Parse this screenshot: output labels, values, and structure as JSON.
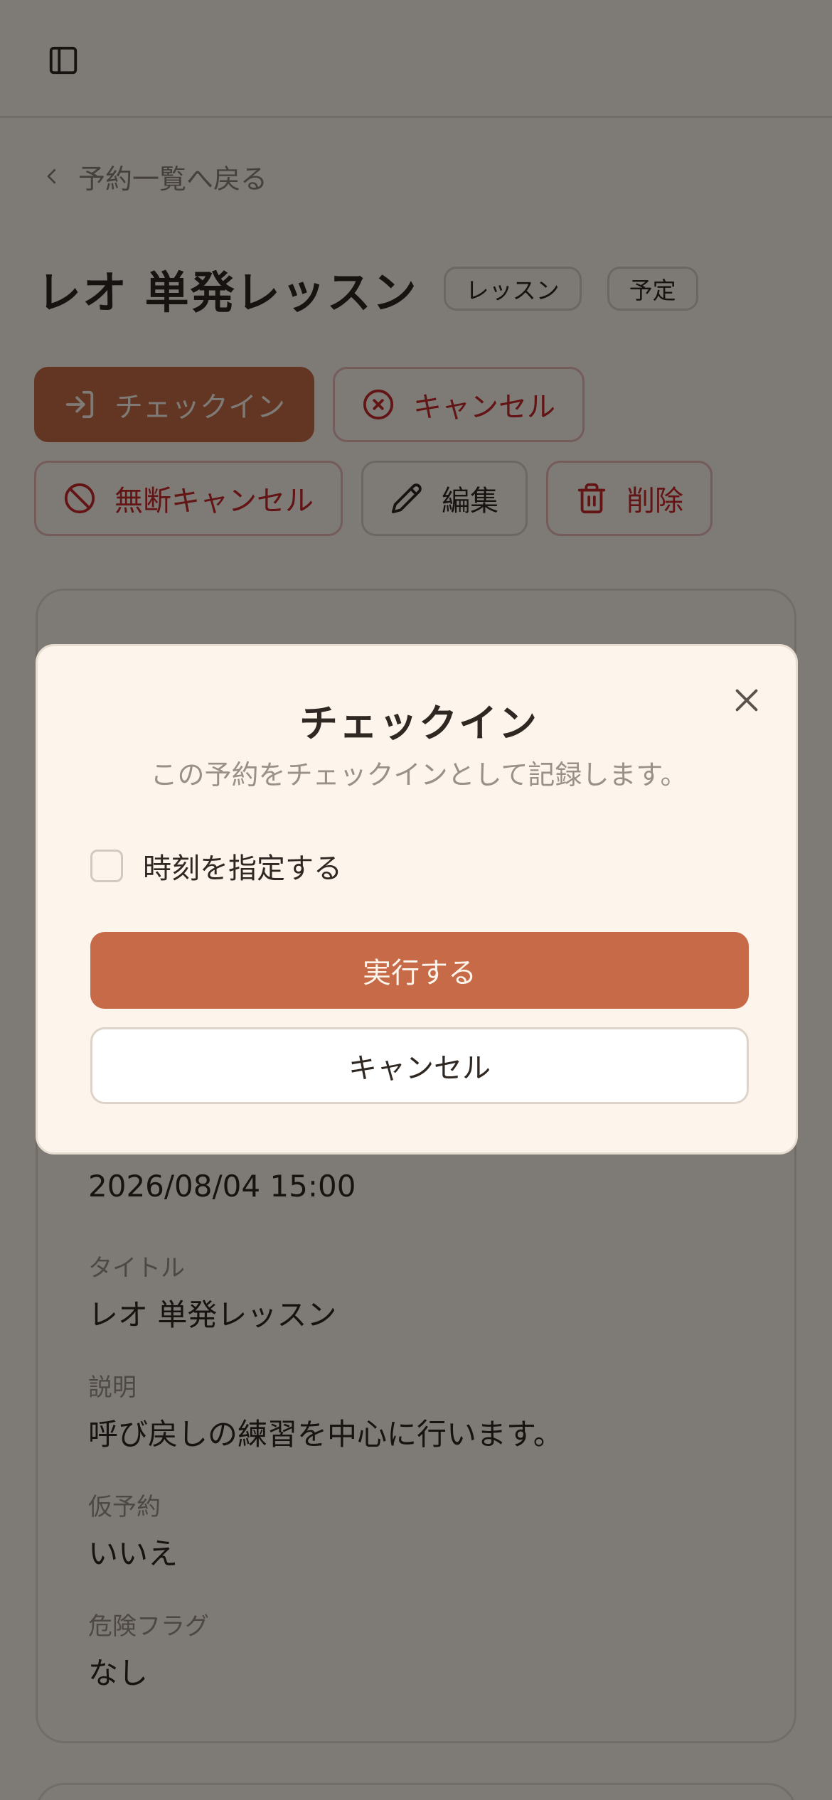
{
  "header": {
    "sidebar_icon": "sidebar-icon"
  },
  "back": {
    "label": "予約一覧へ戻る"
  },
  "reservation": {
    "title": "レオ 単発レッスン",
    "badges": [
      "レッスン",
      "予定"
    ]
  },
  "actions": {
    "checkin": "チェックイン",
    "cancel": "キャンセル",
    "no_show": "無断キャンセル",
    "edit": "編集",
    "delete": "削除"
  },
  "details": {
    "datetime_value": "2026/08/04 15:00",
    "title_label": "タイトル",
    "title_value": "レオ 単発レッスン",
    "description_label": "説明",
    "description_value": "呼び戻しの練習を中心に行います。",
    "tentative_label": "仮予約",
    "tentative_value": "いいえ",
    "danger_label": "危険フラグ",
    "danger_value": "なし"
  },
  "modal": {
    "title": "チェックイン",
    "description": "この予約をチェックインとして記録します。",
    "checkbox_label": "時刻を指定する",
    "confirm_label": "実行する",
    "cancel_label": "キャンセル"
  },
  "colors": {
    "background": "#fdf5ec",
    "primary": "#c66a47",
    "danger": "#c62828",
    "text": "#2e2722",
    "muted": "#9a9088"
  }
}
